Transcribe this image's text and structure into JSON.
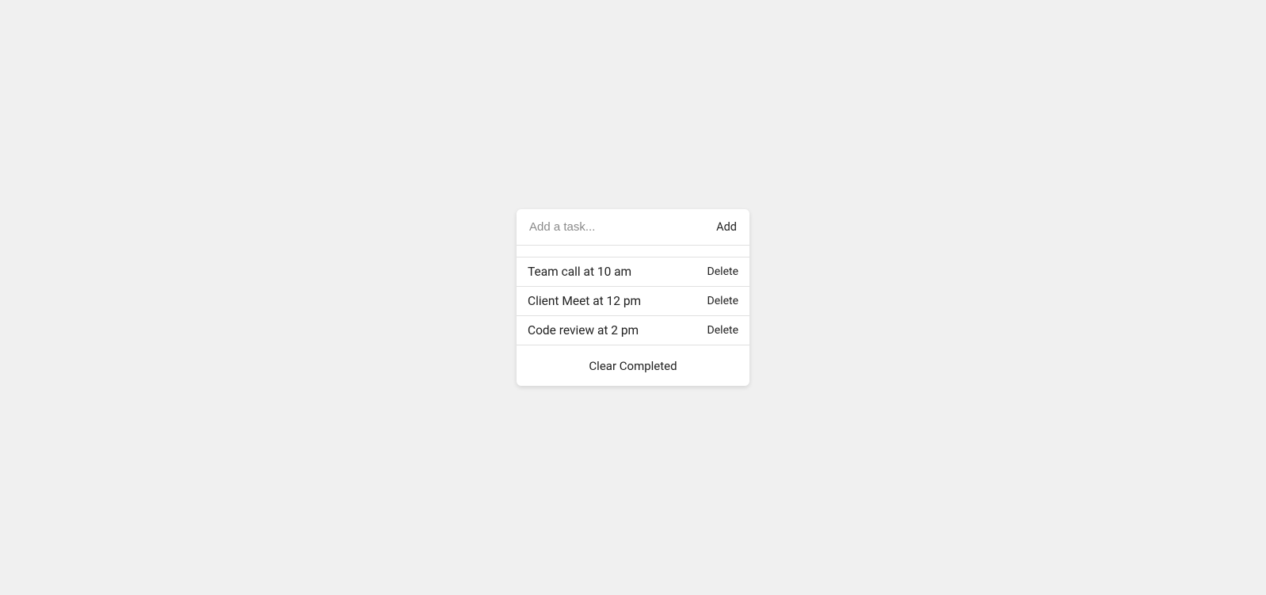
{
  "input": {
    "placeholder": "Add a task...",
    "value": "",
    "add_label": "Add"
  },
  "tasks": [
    {
      "text": "Team call at 10 am",
      "delete_label": "Delete"
    },
    {
      "text": "Client Meet at 12 pm",
      "delete_label": "Delete"
    },
    {
      "text": "Code review at 2 pm",
      "delete_label": "Delete"
    }
  ],
  "footer": {
    "clear_label": "Clear Completed"
  }
}
